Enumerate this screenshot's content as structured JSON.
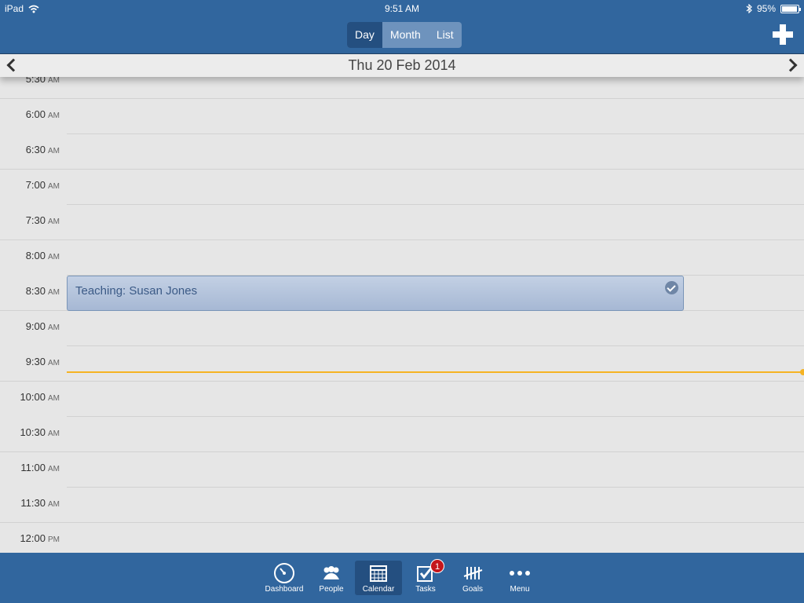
{
  "status_bar": {
    "device": "iPad",
    "time": "9:51 AM",
    "battery": "95%"
  },
  "header": {
    "views": [
      "Day",
      "Month",
      "List"
    ],
    "active_view": "Day"
  },
  "date_bar": {
    "date": "Thu 20 Feb 2014"
  },
  "time_slots": [
    {
      "time": "5:30",
      "ampm": "AM"
    },
    {
      "time": "6:00",
      "ampm": "AM"
    },
    {
      "time": "6:30",
      "ampm": "AM"
    },
    {
      "time": "7:00",
      "ampm": "AM"
    },
    {
      "time": "7:30",
      "ampm": "AM"
    },
    {
      "time": "8:00",
      "ampm": "AM"
    },
    {
      "time": "8:30",
      "ampm": "AM"
    },
    {
      "time": "9:00",
      "ampm": "AM"
    },
    {
      "time": "9:30",
      "ampm": "AM"
    },
    {
      "time": "10:00",
      "ampm": "AM"
    },
    {
      "time": "10:30",
      "ampm": "AM"
    },
    {
      "time": "11:00",
      "ampm": "AM"
    },
    {
      "time": "11:30",
      "ampm": "AM"
    },
    {
      "time": "12:00",
      "ampm": "PM"
    }
  ],
  "event": {
    "title": "Teaching: Susan Jones"
  },
  "tabbar": {
    "items": [
      {
        "label": "Dashboard",
        "icon": "dashboard-icon"
      },
      {
        "label": "People",
        "icon": "people-icon"
      },
      {
        "label": "Calendar",
        "icon": "calendar-icon"
      },
      {
        "label": "Tasks",
        "icon": "tasks-icon",
        "badge": "1"
      },
      {
        "label": "Goals",
        "icon": "goals-icon"
      },
      {
        "label": "Menu",
        "icon": "menu-icon"
      }
    ],
    "active": "Calendar"
  },
  "colors": {
    "primary": "#31669e",
    "active_tab": "#244f80",
    "event_fill": "#b3c3dc",
    "now_line": "#f5b323",
    "badge": "#c4161c"
  }
}
